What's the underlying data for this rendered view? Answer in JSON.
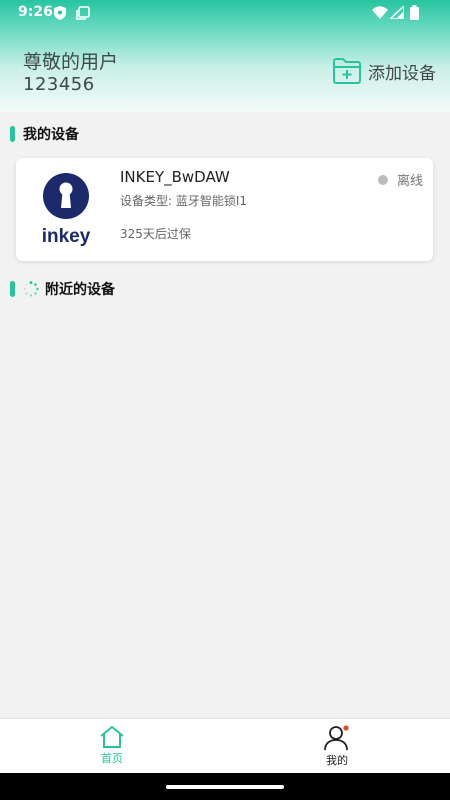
{
  "status_bar": {
    "time": "9:26"
  },
  "header": {
    "greeting": "尊敬的用户",
    "user_id": "123456",
    "add_device_label": "添加设备"
  },
  "sections": {
    "my_devices_title": "我的设备",
    "nearby_devices_title": "附近的设备"
  },
  "devices": [
    {
      "name": "INKEY_BwDAW",
      "logo_text": "inkey",
      "type_line": "设备类型: 蓝牙智能锁I1",
      "warranty": "325天后过保",
      "status": "离线",
      "status_color": "#bbbbbb"
    }
  ],
  "tabbar": {
    "home_label": "首页",
    "mine_label": "我的"
  },
  "colors": {
    "accent": "#27c4a0",
    "brand_navy": "#1c2a6b",
    "notification_dot": "#e8452c"
  }
}
